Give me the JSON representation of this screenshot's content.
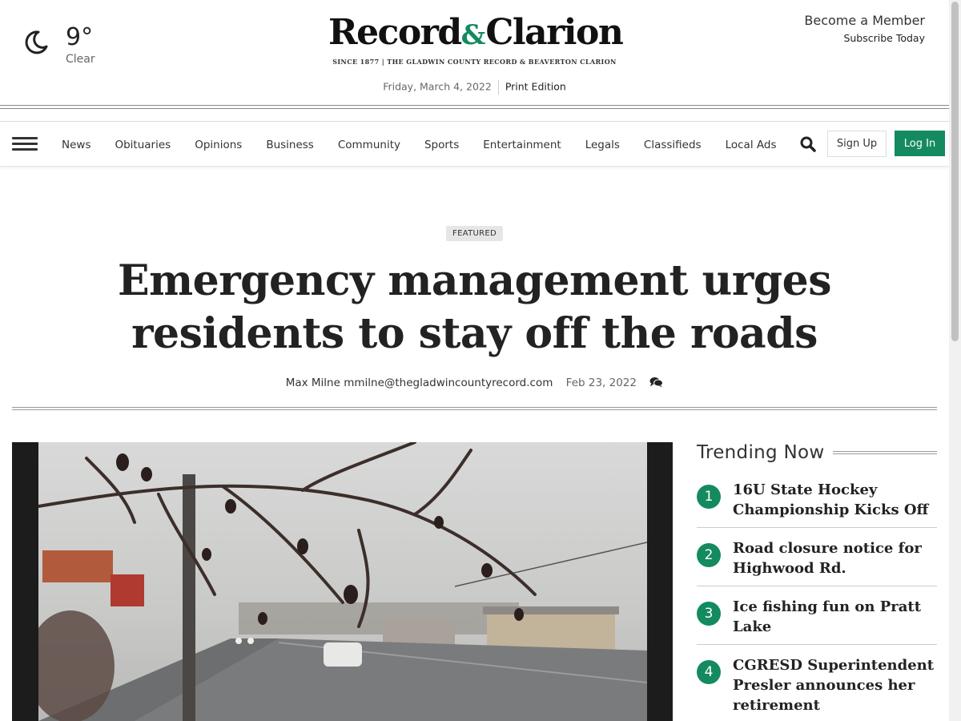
{
  "weather": {
    "temperature": "9°",
    "condition": "Clear",
    "icon": "moon-icon"
  },
  "masthead": {
    "logo_left": "Record",
    "logo_amp": "&",
    "logo_right": "Clarion",
    "tagline": "SINCE 1877  |  THE GLADWIN COUNTY RECORD & BEAVERTON CLARION",
    "date": "Friday, March 4, 2022",
    "print_edition": "Print Edition"
  },
  "membership": {
    "become": "Become a Member",
    "subscribe": "Subscribe Today"
  },
  "nav": {
    "items": [
      "News",
      "Obituaries",
      "Opinions",
      "Business",
      "Community",
      "Sports",
      "Entertainment",
      "Legals",
      "Classifieds",
      "Local Ads"
    ],
    "sign_up": "Sign Up",
    "log_in": "Log In"
  },
  "article": {
    "badge": "FEATURED",
    "headline": "Emergency management urges residents to stay off the roads",
    "author": "Max Milne mmilne@thegladwincountyrecord.com",
    "date": "Feb 23, 2022"
  },
  "trending": {
    "title": "Trending Now",
    "items": [
      {
        "rank": "1",
        "title": "16U State Hockey Championship Kicks Off"
      },
      {
        "rank": "2",
        "title": "Road closure notice for Highwood Rd."
      },
      {
        "rank": "3",
        "title": "Ice fishing fun on Pratt Lake"
      },
      {
        "rank": "4",
        "title": "CGRESD Superintendent Presler announces her retirement"
      }
    ]
  },
  "colors": {
    "accent": "#148a5f",
    "text": "#222222"
  }
}
